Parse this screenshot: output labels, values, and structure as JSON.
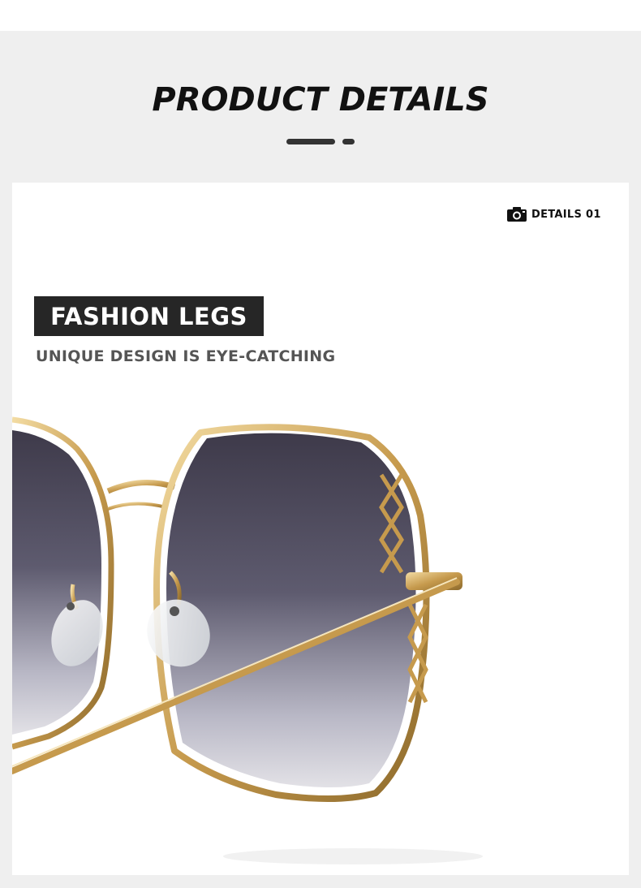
{
  "header": {
    "title": "PRODUCT DETAILS"
  },
  "details_tag": {
    "icon": "camera-icon",
    "label": "DETAILS 01"
  },
  "feature": {
    "title": "FASHION LEGS",
    "subtitle": "UNIQUE DESIGN IS EYE-CATCHING"
  },
  "product_image": {
    "subject": "sunglasses-gold-frame-gradient-lens"
  },
  "colors": {
    "section_bg": "#efefef",
    "card_bg": "#ffffff",
    "title_text": "#111111",
    "feature_box_bg": "#262626",
    "subtitle_text": "#555555",
    "frame_gold": "#c9a45c",
    "lens_dark": "#4a4756"
  }
}
